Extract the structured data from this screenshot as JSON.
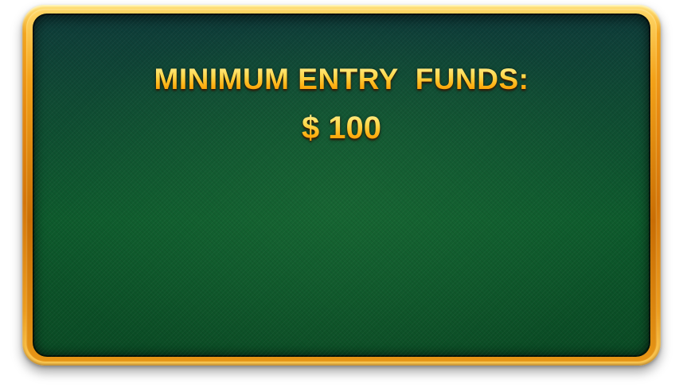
{
  "panel": {
    "title": "MINIMUM ENTRY  FUNDS:",
    "amount": "$ 100"
  },
  "colors": {
    "frame_gold": "#f3a21a",
    "panel_green": "#0d5a2c",
    "text_gold": "#ffc22e"
  }
}
